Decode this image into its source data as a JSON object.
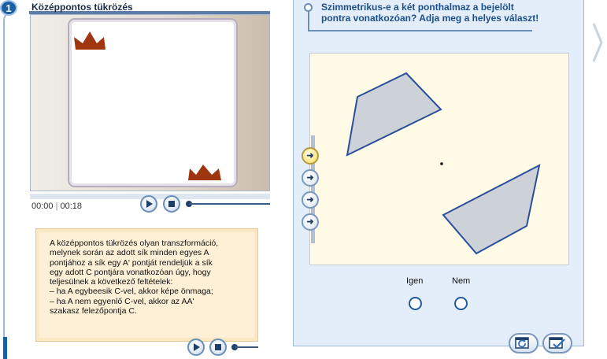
{
  "lesson": {
    "number": "1",
    "title": "Középpontos tükrözés"
  },
  "video": {
    "time_current": "00:00",
    "time_total": "00:18",
    "progress": 0
  },
  "explanation": {
    "lines": [
      "A középpontos tükrözés olyan transzformáció,",
      "melynek során az adott sík minden egyes A",
      "pontjához a sík egy A' pontját rendeljük a sík",
      "egy adott C pontjára vonatkozóan úgy, hogy",
      "teljesülnek a következő feltételek:",
      "– ha A egybeesik C-vel, akkor képe önmaga;",
      "– ha A nem egyenlő C-vel, akkor az AA'",
      "szakasz felezőpontja C."
    ]
  },
  "question": {
    "text_line1": "Szimmetrikus-e a két ponthalmaz a bejelölt",
    "text_line2": "pontra vonatkozóan? Adja meg a helyes választ!"
  },
  "options": {
    "yes": "Igen",
    "no": "Nem"
  },
  "colors": {
    "accent": "#1b5fa4",
    "shape_fill": "#cdd2d8",
    "shape_stroke": "#2a4f9a",
    "crown": "#a0360f",
    "canvas_bg": "#fffbe6"
  },
  "icons": {
    "play": "play-icon",
    "stop": "stop-icon",
    "arrow": "arrow-right-icon",
    "refresh": "refresh-window-icon",
    "check": "check-window-icon"
  }
}
